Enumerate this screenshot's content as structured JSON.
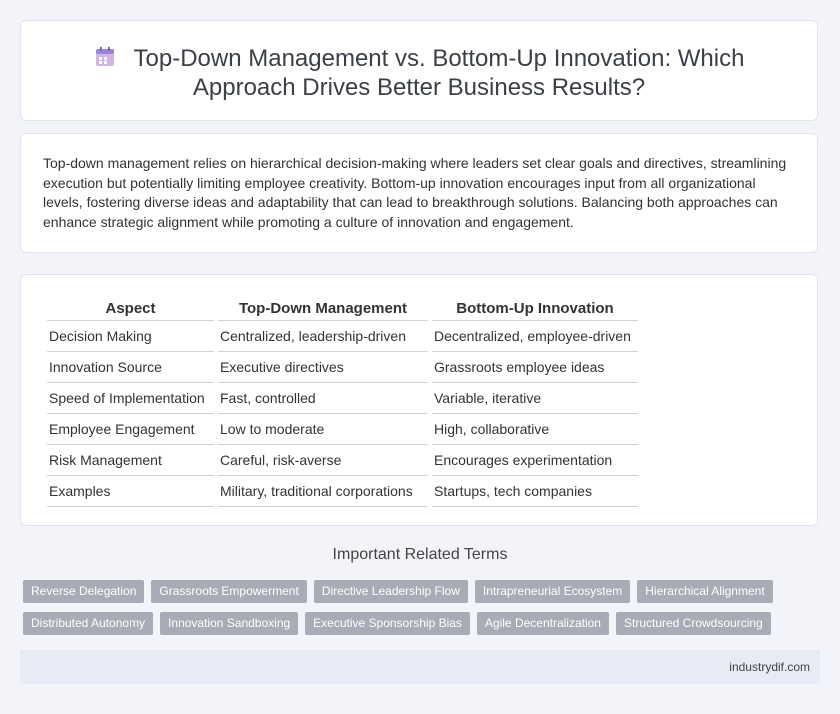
{
  "page": {
    "title_line1": "Top-Down Management vs. Bottom-Up Innovation: Which",
    "title_line2": "Approach Drives Better Business Results?",
    "title_icon": "calendar-icon"
  },
  "intro": "Top-down management relies on hierarchical decision-making where leaders set clear goals and directives, streamlining execution but potentially limiting employee creativity. Bottom-up innovation encourages input from all organizational levels, fostering diverse ideas and adaptability that can lead to breakthrough solutions. Balancing both approaches can enhance strategic alignment while promoting a culture of innovation and engagement.",
  "table": {
    "headers": [
      "Aspect",
      "Top-Down Management",
      "Bottom-Up Innovation"
    ],
    "rows": [
      [
        "Decision Making",
        "Centralized, leadership-driven",
        "Decentralized, employee-driven"
      ],
      [
        "Innovation Source",
        "Executive directives",
        "Grassroots employee ideas"
      ],
      [
        "Speed of Implementation",
        "Fast, controlled",
        "Variable, iterative"
      ],
      [
        "Employee Engagement",
        "Low to moderate",
        "High, collaborative"
      ],
      [
        "Risk Management",
        "Careful, risk-averse",
        "Encourages experimentation"
      ],
      [
        "Examples",
        "Military, traditional corporations",
        "Startups, tech companies"
      ]
    ]
  },
  "related": {
    "heading": "Important Related Terms",
    "row1": [
      "Reverse Delegation",
      "Grassroots Empowerment",
      "Directive Leadership Flow",
      "Intrapreneurial Ecosystem",
      "Hierarchical Alignment"
    ],
    "row2": [
      "Distributed Autonomy",
      "Innovation Sandboxing",
      "Executive Sponsorship Bias",
      "Agile Decentralization",
      "Structured Crowdsourcing"
    ]
  },
  "footer": {
    "site": "industrydif.com"
  },
  "colors": {
    "tag_bg": "#a8acb6",
    "footer_bg": "#e6ebf5",
    "page_bg": "#f3f4f9"
  }
}
